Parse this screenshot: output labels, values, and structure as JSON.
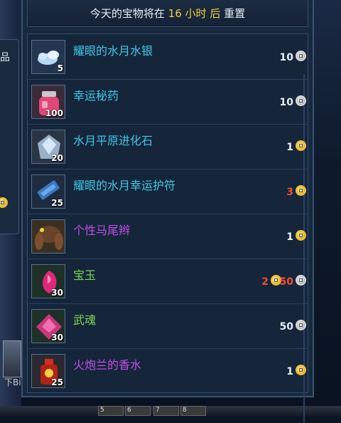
{
  "header": {
    "prefix": "今天的宝物将在",
    "hours": "16",
    "hours_unit": "小时",
    "after": "后",
    "suffix": "重置"
  },
  "side_panel": {
    "text": "品"
  },
  "left_hud": {
    "label": "下Bi"
  },
  "hotkeys": [
    "5",
    "6",
    "7",
    "8"
  ],
  "currency_icons": {
    "silver": "silver-coin-icon",
    "gold": "gold-coin-icon"
  },
  "items": [
    {
      "name": "耀眼的水月水银",
      "qty": "5",
      "name_color": "#40c8e8",
      "icon": "mercury-icon",
      "price": [
        {
          "amount": "10",
          "currency": "silver"
        }
      ]
    },
    {
      "name": "幸运秘药",
      "qty": "100",
      "name_color": "#40c8e8",
      "icon": "potion-jar-icon",
      "price": [
        {
          "amount": "10",
          "currency": "silver"
        }
      ]
    },
    {
      "name": "水月平原进化石",
      "qty": "20",
      "name_color": "#40c8e8",
      "icon": "evolution-stone-icon",
      "price": [
        {
          "amount": "1",
          "currency": "gold"
        }
      ]
    },
    {
      "name": "耀眼的水月幸运护符",
      "qty": "25",
      "name_color": "#40c8e8",
      "icon": "talisman-icon",
      "price": [
        {
          "amount": "3",
          "currency": "gold",
          "amount_color": "#f05030"
        }
      ]
    },
    {
      "name": "个性马尾辫",
      "qty": "",
      "name_color": "#c050e8",
      "icon": "ponytail-icon",
      "price": [
        {
          "amount": "1",
          "currency": "gold"
        }
      ]
    },
    {
      "name": "宝玉",
      "qty": "30",
      "name_color": "#7ad858",
      "icon": "gem-icon",
      "price": [
        {
          "amount": "2",
          "currency": "gold",
          "amount_color": "#f05030"
        },
        {
          "amount": "50",
          "currency": "silver",
          "amount_color": "#f05030"
        }
      ]
    },
    {
      "name": "武魂",
      "qty": "30",
      "name_color": "#7ad858",
      "icon": "soul-crystal-icon",
      "price": [
        {
          "amount": "50",
          "currency": "silver"
        }
      ]
    },
    {
      "name": "火炮兰的香水",
      "qty": "25",
      "name_color": "#c050e8",
      "icon": "perfume-bottle-icon",
      "price": [
        {
          "amount": "1",
          "currency": "gold"
        }
      ]
    }
  ]
}
